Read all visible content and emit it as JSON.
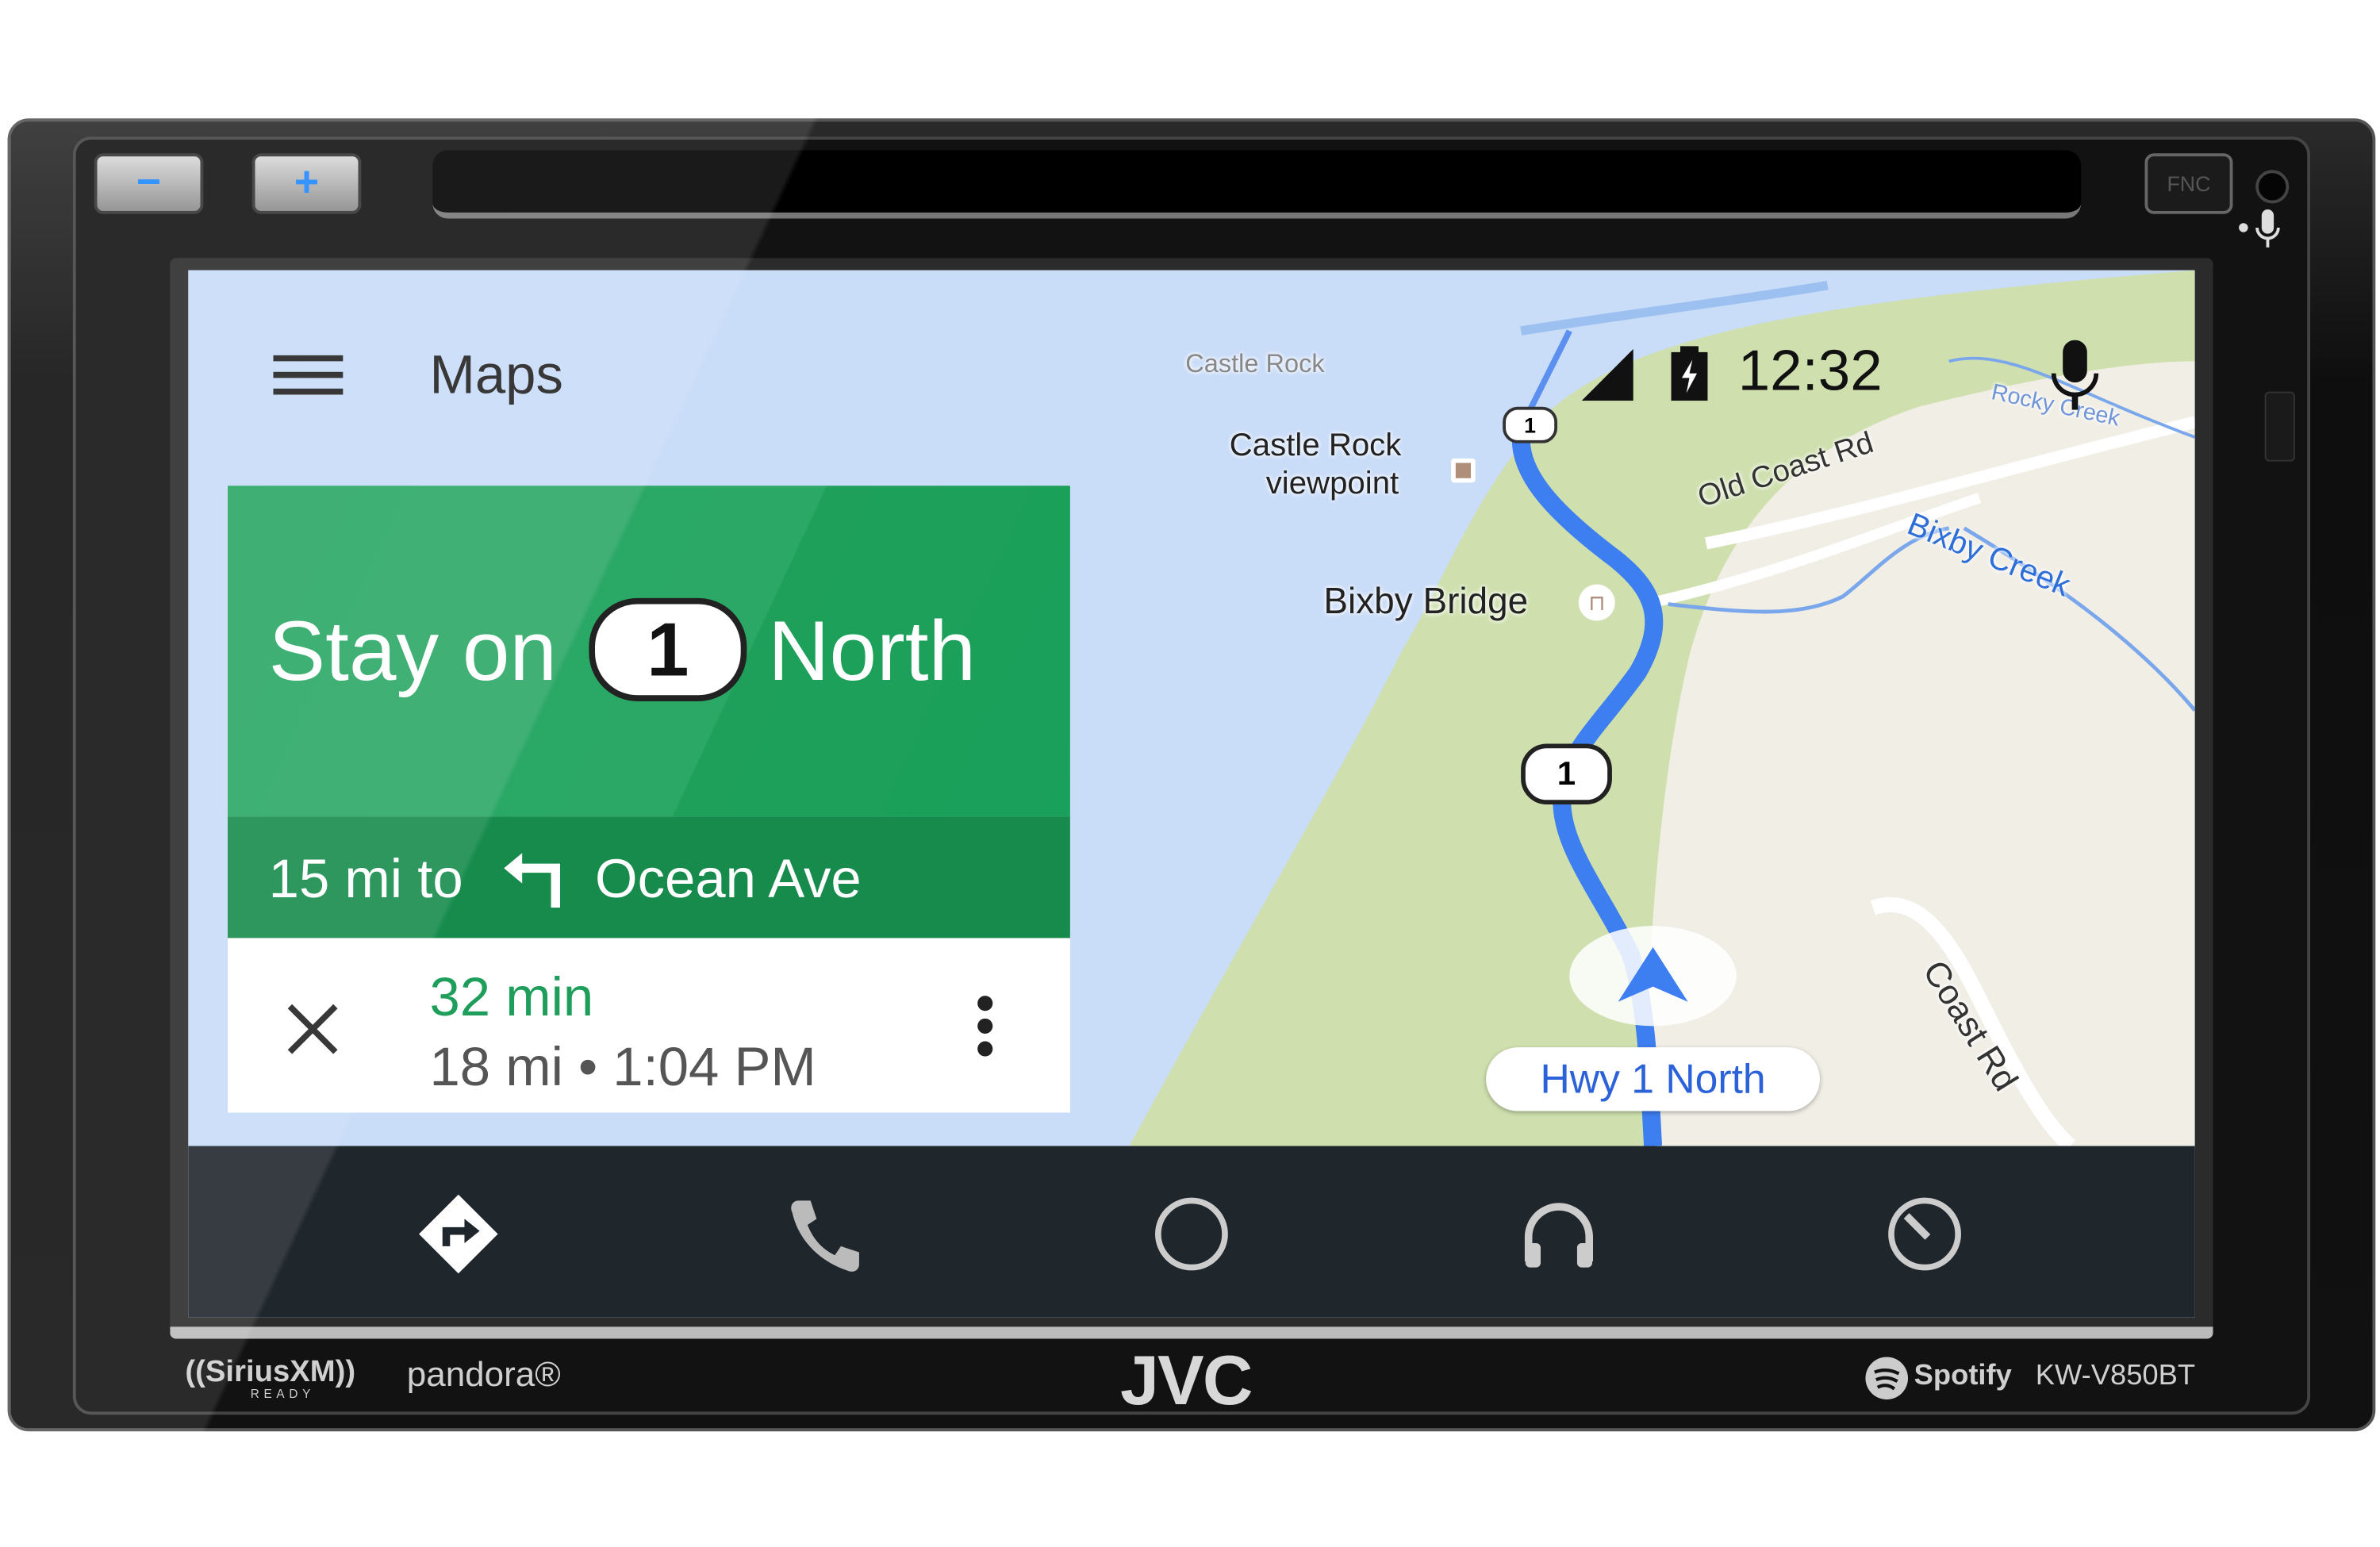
{
  "device": {
    "brand": "JVC",
    "model": "KW-V850BT",
    "buttons": {
      "volume_down": "−",
      "volume_up": "+",
      "fnc": "FNC"
    },
    "logos": {
      "siriusxm": "((SiriusXM))",
      "siriusxm_sub": "READY",
      "pandora": "pandora®",
      "spotify": "Spotify"
    }
  },
  "header": {
    "title": "Maps",
    "time": "12:32",
    "icons": {
      "menu": "hamburger-icon",
      "signal": "signal-icon",
      "battery": "battery-charging-icon",
      "voice": "mic-icon"
    }
  },
  "navigation_card": {
    "instruction_prefix": "Stay on",
    "route_shield": "1",
    "instruction_suffix": "North",
    "next_distance": "15 mi to",
    "next_turn_icon": "turn-left-icon",
    "next_street": "Ocean Ave",
    "eta_duration": "32 min",
    "eta_details": "18 mi • 1:04 PM",
    "accent_color": "#1e9e5a"
  },
  "map": {
    "labels": {
      "castle_rock": "Castle Rock",
      "castle_rock_viewpoint_1": "Castle Rock",
      "castle_rock_viewpoint_2": "viewpoint",
      "bixby_bridge": "Bixby Bridge",
      "old_coast_rd": "Old Coast Rd",
      "bixby_creek": "Bixby Creek",
      "rocky_creek": "Rocky Creek",
      "coast_rd": "Coast Rd",
      "shield_1": "1",
      "shield_2": "1"
    },
    "current_road": "Hwy 1 North",
    "route_color": "#3d7ef0"
  },
  "bottom_nav": [
    {
      "id": "navigation",
      "icon": "navigation-icon"
    },
    {
      "id": "phone",
      "icon": "phone-icon"
    },
    {
      "id": "home",
      "icon": "home-circle-icon"
    },
    {
      "id": "media",
      "icon": "headphones-icon"
    },
    {
      "id": "recents",
      "icon": "dashboard-icon"
    }
  ]
}
